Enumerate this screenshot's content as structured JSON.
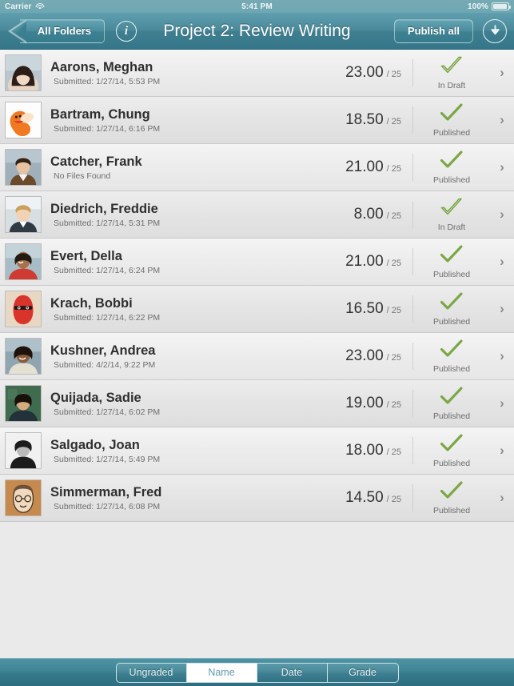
{
  "status_bar": {
    "carrier": "Carrier",
    "wifi_icon": "wifi-icon",
    "time": "5:41 PM",
    "battery_percent": "100%",
    "battery_icon": "battery-icon"
  },
  "navbar": {
    "back_label": "All Folders",
    "info_icon": "info-icon",
    "info_glyph": "i",
    "title": "Project 2: Review Writing",
    "publish_all_label": "Publish all",
    "download_icon": "download-icon"
  },
  "colors": {
    "nav_teal": "#3f7f90",
    "toolbar_teal": "#357a8c",
    "check_green": "#7aa744",
    "row_light": "#f0f0f0",
    "row_dark": "#e6e6e6",
    "selected_segment_text": "#5e9aa8"
  },
  "list": {
    "max_points_label": "/ 25",
    "rows": [
      {
        "name": "Aarons, Meghan",
        "sub": "Submitted: 1/27/14, 5:53 PM",
        "score": "23.00",
        "max": "/ 25",
        "status": "In Draft",
        "status_icon": "check-outline-icon",
        "avatar": "photo-woman-dark-hair",
        "chevron": "chevron-right-icon"
      },
      {
        "name": "Bartram, Chung",
        "sub": "Submitted: 1/27/14, 6:16 PM",
        "score": "18.50",
        "max": "/ 25",
        "status": "Published",
        "status_icon": "check-solid-icon",
        "avatar": "cartoon-orange-creature",
        "chevron": "chevron-right-icon"
      },
      {
        "name": "Catcher, Frank",
        "sub": "No Files Found",
        "score": "21.00",
        "max": "/ 25",
        "status": "Published",
        "status_icon": "check-solid-icon",
        "avatar": "photo-man-brown-jacket",
        "chevron": "chevron-right-icon"
      },
      {
        "name": "Diedrich, Freddie",
        "sub": "Submitted: 1/27/14, 5:31 PM",
        "score": "8.00",
        "max": "/ 25",
        "status": "In Draft",
        "status_icon": "check-outline-icon",
        "avatar": "photo-man-blond-suit",
        "chevron": "chevron-right-icon"
      },
      {
        "name": "Evert, Della",
        "sub": "Submitted: 1/27/14, 6:24 PM",
        "score": "21.00",
        "max": "/ 25",
        "status": "Published",
        "status_icon": "check-solid-icon",
        "avatar": "photo-woman-red-top",
        "chevron": "chevron-right-icon"
      },
      {
        "name": "Krach, Bobbi",
        "sub": "Submitted: 1/27/14, 6:22 PM",
        "score": "16.50",
        "max": "/ 25",
        "status": "Published",
        "status_icon": "check-solid-icon",
        "avatar": "cartoon-red-ninja",
        "chevron": "chevron-right-icon"
      },
      {
        "name": "Kushner, Andrea",
        "sub": "Submitted: 4/2/14, 9:22 PM",
        "score": "23.00",
        "max": "/ 25",
        "status": "Published",
        "status_icon": "check-solid-icon",
        "avatar": "photo-woman-smiling",
        "chevron": "chevron-right-icon"
      },
      {
        "name": "Quijada, Sadie",
        "sub": "Submitted: 1/27/14, 6:02 PM",
        "score": "19.00",
        "max": "/ 25",
        "status": "Published",
        "status_icon": "check-solid-icon",
        "avatar": "photo-woman-chalkboard",
        "chevron": "chevron-right-icon"
      },
      {
        "name": "Salgado, Joan",
        "sub": "Submitted: 1/27/14, 5:49 PM",
        "score": "18.00",
        "max": "/ 25",
        "status": "Published",
        "status_icon": "check-solid-icon",
        "avatar": "silhouette-avatar",
        "chevron": "chevron-right-icon"
      },
      {
        "name": "Simmerman, Fred",
        "sub": "Submitted: 1/27/14, 6:08 PM",
        "score": "14.50",
        "max": "/ 25",
        "status": "Published",
        "status_icon": "check-solid-icon",
        "avatar": "cartoon-man-glasses",
        "chevron": "chevron-right-icon"
      }
    ]
  },
  "toolbar": {
    "segments": [
      {
        "label": "Ungraded",
        "selected": false
      },
      {
        "label": "Name",
        "selected": true
      },
      {
        "label": "Date",
        "selected": false
      },
      {
        "label": "Grade",
        "selected": false
      }
    ]
  }
}
